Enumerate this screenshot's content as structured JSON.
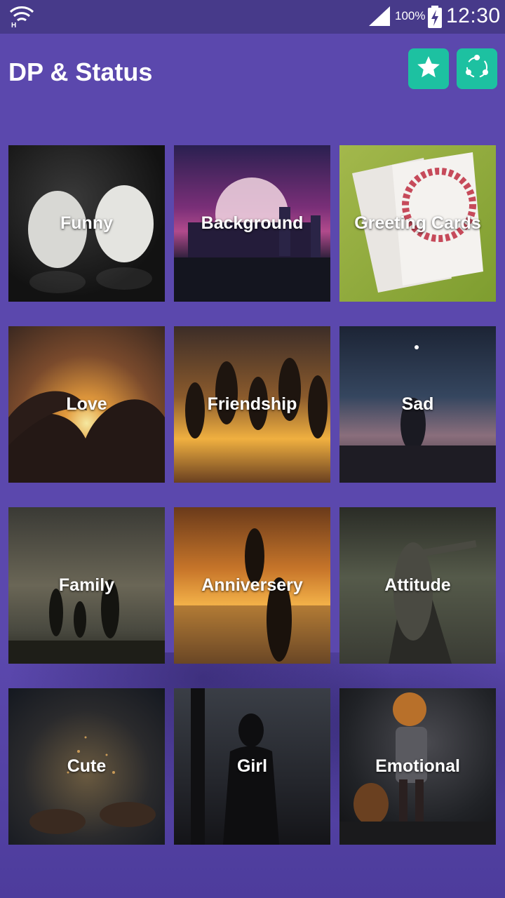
{
  "status_bar": {
    "battery_percent": "100%",
    "time": "12:30",
    "icons": [
      "wifi-icon",
      "signal-icon",
      "battery-charging-icon"
    ]
  },
  "app": {
    "title": "DP & Status",
    "accent_color": "#1dc1a1",
    "background_color": "#5b48ad",
    "actions": [
      {
        "name": "rate",
        "icon": "star-icon"
      },
      {
        "name": "share",
        "icon": "share-icon"
      }
    ]
  },
  "categories": [
    {
      "label": "Funny"
    },
    {
      "label": "Background"
    },
    {
      "label": "Greeting Cards"
    },
    {
      "label": "Love"
    },
    {
      "label": "Friendship"
    },
    {
      "label": "Sad"
    },
    {
      "label": "Family"
    },
    {
      "label": "Anniversery"
    },
    {
      "label": "Attitude"
    },
    {
      "label": "Cute"
    },
    {
      "label": "Girl"
    },
    {
      "label": "Emotional"
    }
  ]
}
